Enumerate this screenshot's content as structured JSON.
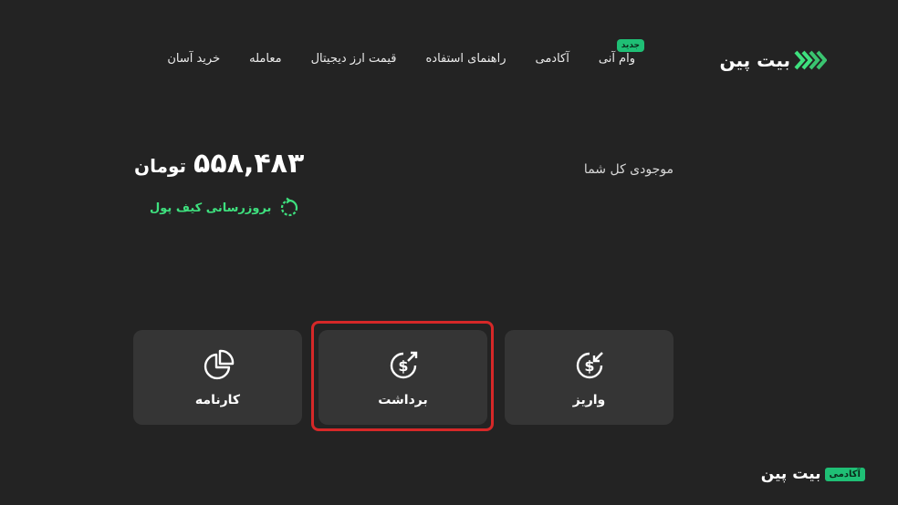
{
  "brand": {
    "name": "بیت پین"
  },
  "nav": {
    "items": [
      "خرید آسان",
      "معامله",
      "قیمت ارز دیجیتال",
      "راهنمای استفاده",
      "آکادمی",
      "وام آنی"
    ],
    "new_badge": "جدید"
  },
  "balance": {
    "label": "موجودی کل شما",
    "amount": "۵۵۸,۴۸۳",
    "unit": "تومان",
    "refresh_label": "بروزرسانی کیف پول"
  },
  "actions": {
    "deposit": "واریز",
    "withdraw": "برداشت",
    "report": "کارنامه"
  },
  "footer": {
    "badge": "آکادمی",
    "brand": "بیت پین"
  },
  "colors": {
    "background": "#232323",
    "card": "#353535",
    "accent_green": "#3ee07e",
    "highlight_red": "#d62828"
  }
}
